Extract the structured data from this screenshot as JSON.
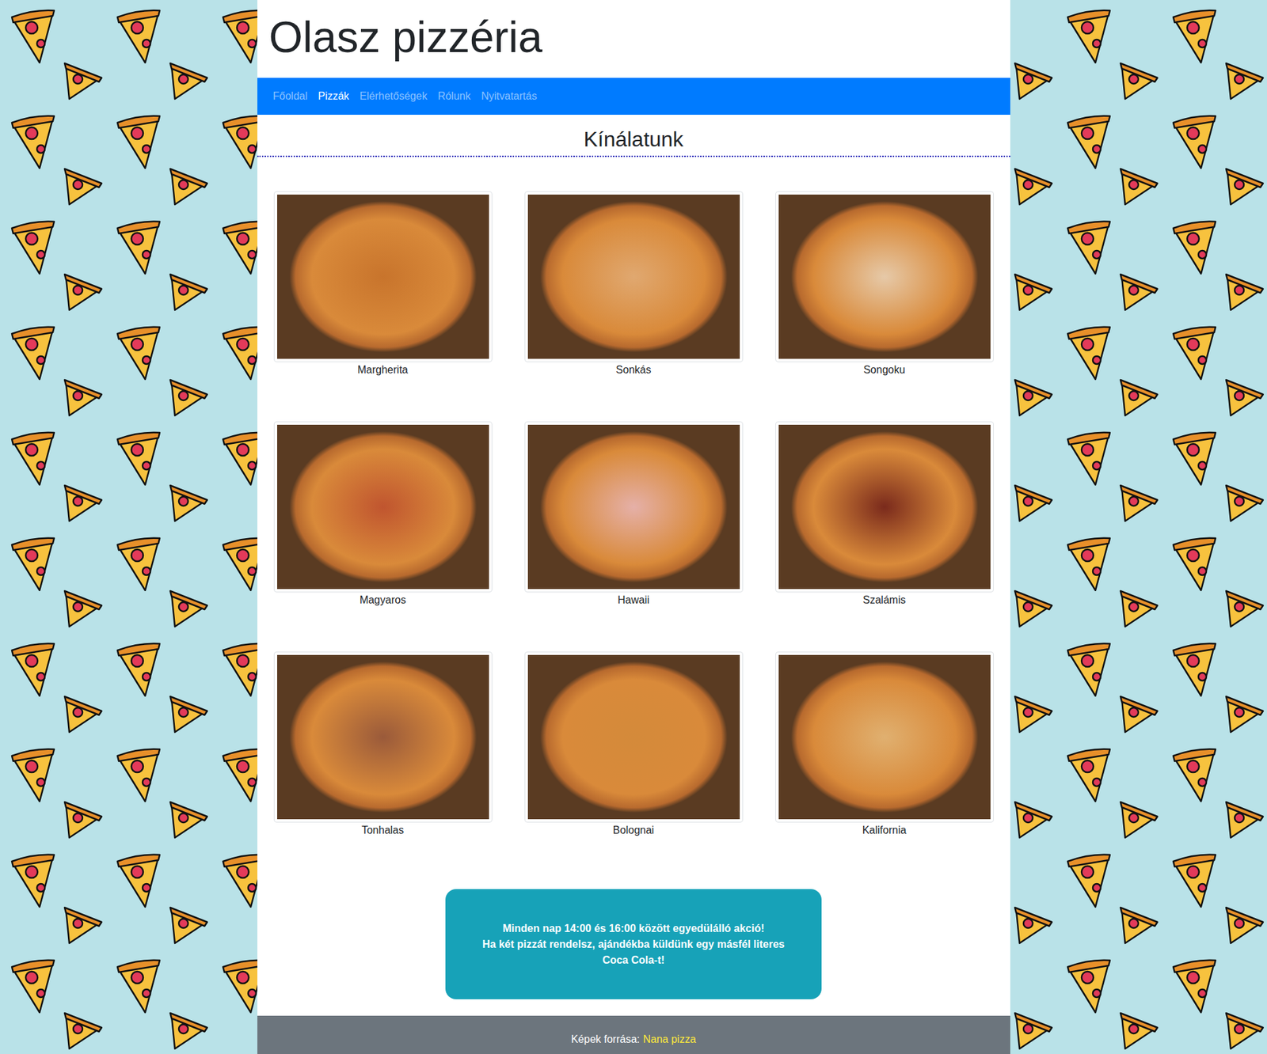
{
  "header": {
    "title": "Olasz pizzéria"
  },
  "nav": [
    {
      "label": "Főoldal",
      "selected": false
    },
    {
      "label": "Pizzák",
      "selected": true
    },
    {
      "label": "Elérhetőségek",
      "selected": false
    },
    {
      "label": "Rólunk",
      "selected": false
    },
    {
      "label": "Nyitvatartás",
      "selected": false
    }
  ],
  "section": {
    "title": "Kínálatunk"
  },
  "pizzas": [
    {
      "name": "Margherita"
    },
    {
      "name": "Sonkás"
    },
    {
      "name": "Songoku"
    },
    {
      "name": "Magyaros"
    },
    {
      "name": "Hawaii"
    },
    {
      "name": "Szalámis"
    },
    {
      "name": "Tonhalas"
    },
    {
      "name": "Bolognai"
    },
    {
      "name": "Kalifornia"
    }
  ],
  "promo": {
    "lines": [
      "Minden nap 14:00 és 16:00 között egyedülálló akció!",
      "Ha két pizzát rendelsz, ajándékba küldünk egy másfél literes Coca Cola-t!"
    ]
  },
  "footer": {
    "label": "Képek forrása:",
    "link": "Nana pizza"
  }
}
